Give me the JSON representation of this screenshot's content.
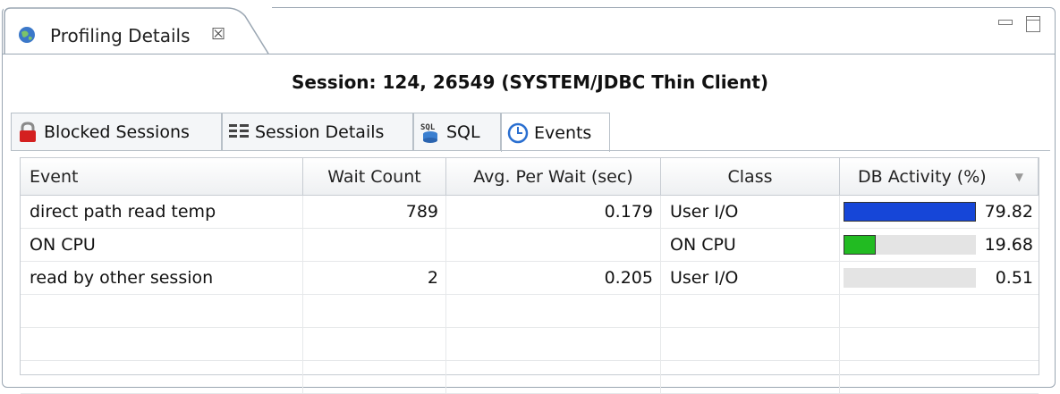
{
  "view": {
    "title": "Profiling Details",
    "close_glyph": "☒"
  },
  "session_label": "Session: 124, 26549 (SYSTEM/JDBC Thin Client)",
  "tabs": [
    {
      "label": "Blocked Sessions",
      "icon": "lock-icon"
    },
    {
      "label": "Session Details",
      "icon": "details-icon"
    },
    {
      "label": "SQL",
      "icon": "sql-icon"
    },
    {
      "label": "Events",
      "icon": "clock-icon",
      "active": true
    }
  ],
  "table": {
    "columns": [
      "Event",
      "Wait Count",
      "Avg. Per Wait (sec)",
      "Class",
      "DB Activity (%)"
    ],
    "sort_indicator": "▼",
    "rows": [
      {
        "event": "direct path read temp",
        "wait_count": "789",
        "avg_per_wait": "0.179",
        "class": "User I/O",
        "db_activity": "79.82",
        "bar_color": "#1646d8",
        "bar_fraction": 0.9982
      },
      {
        "event": "ON CPU",
        "wait_count": "",
        "avg_per_wait": "",
        "class": "ON CPU",
        "db_activity": "19.68",
        "bar_color": "#22bb22",
        "bar_fraction": 0.2461
      },
      {
        "event": "read by other session",
        "wait_count": "2",
        "avg_per_wait": "0.205",
        "class": "User I/O",
        "db_activity": "0.51",
        "bar_color": "#e4e4e4",
        "bar_fraction": 0.0
      }
    ]
  }
}
